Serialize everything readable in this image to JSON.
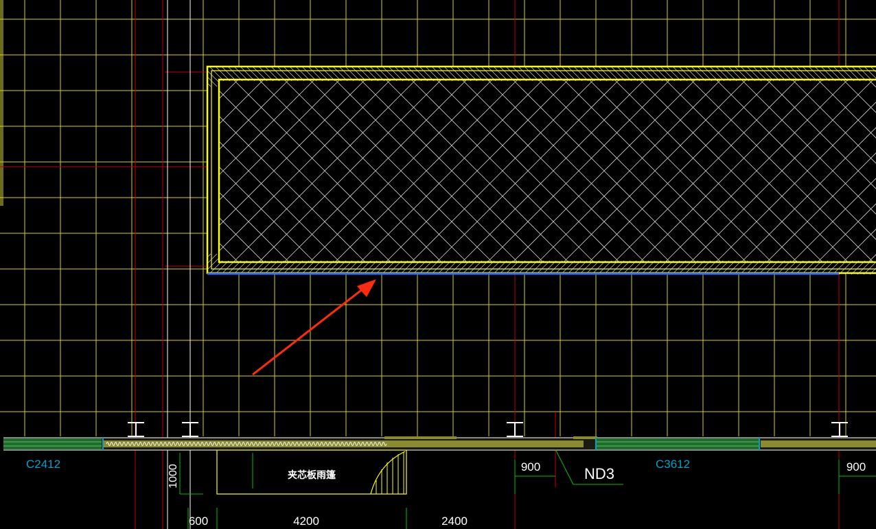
{
  "labels": {
    "window_c2412": "C2412",
    "window_c3612": "C3612",
    "canopy": "夹芯板雨篷",
    "door_tag": "ND3"
  },
  "dimensions": {
    "d_1000": "1000",
    "d_600": "600",
    "d_4200": "4200",
    "d_2400": "2400",
    "d_900_left": "900",
    "d_900_right": "900"
  },
  "colors": {
    "background": "#000000",
    "grid": "#d6d600",
    "axis": "#c00000",
    "outline": "#ffff00",
    "hatch": "#d0d0d0",
    "slab_edge": "#3366ff",
    "arrow": "#ff2a10",
    "window": "#00a0c8",
    "wall": "#8a8a30",
    "text_white": "#ffffff",
    "text_cyan": "#00a0c8",
    "dim_green": "#00c000"
  }
}
